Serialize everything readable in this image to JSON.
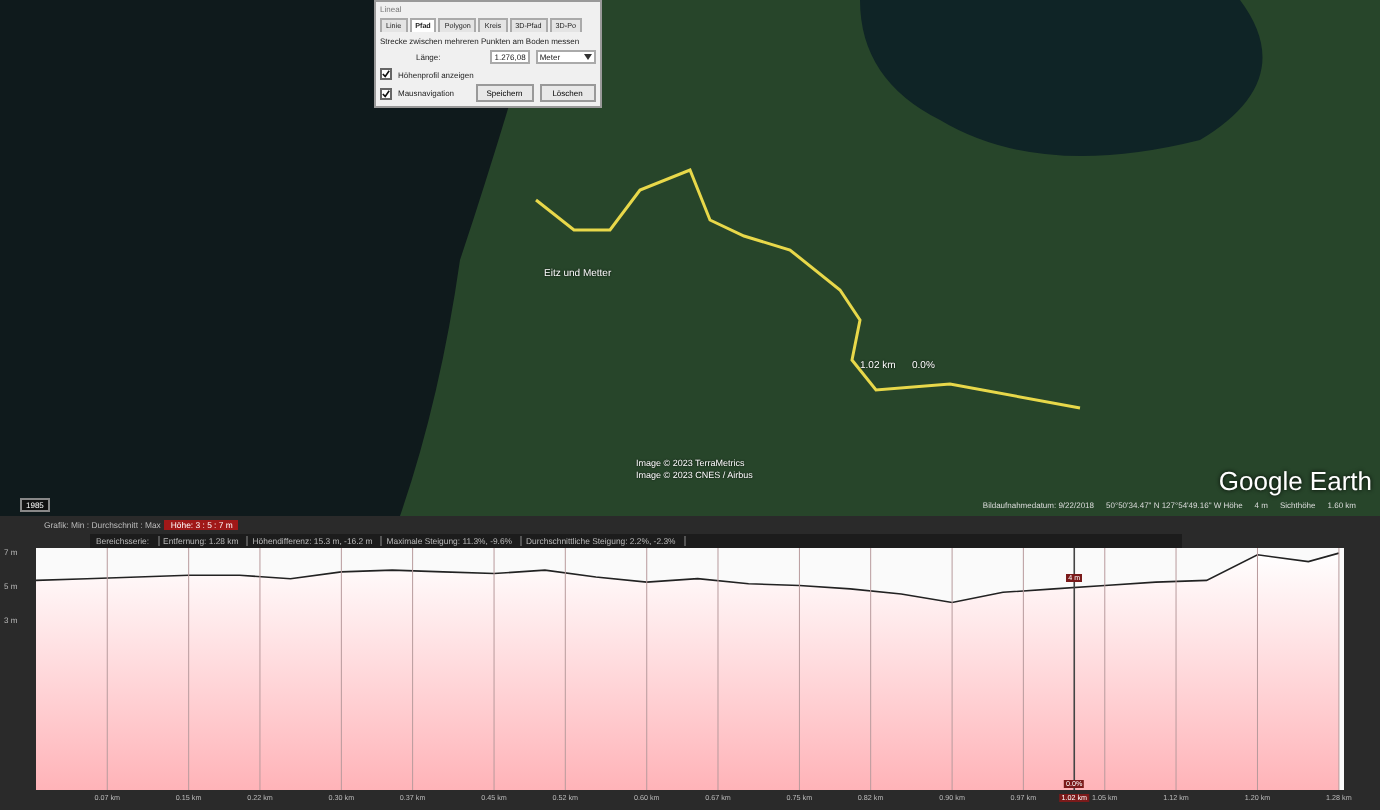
{
  "ruler_dialog": {
    "title": "Lineal",
    "tabs": [
      {
        "label": "Linie",
        "selected": false
      },
      {
        "label": "Pfad",
        "selected": true
      },
      {
        "label": "Polygon",
        "selected": false
      },
      {
        "label": "Kreis",
        "selected": false
      },
      {
        "label": "3D-Pfad",
        "selected": false
      },
      {
        "label": "3D-Po",
        "selected": false
      }
    ],
    "description": "Strecke zwischen mehreren Punkten am Boden messen",
    "length_label": "Länge:",
    "length_value": "1.276,08",
    "unit": "Meter",
    "elevation_profile_checkbox": {
      "label": "Höhenprofil anzeigen",
      "checked": true
    },
    "mouse_navigation_checkbox": {
      "label": "Mausnavigation",
      "checked": true
    },
    "buttons": [
      "Speichern",
      "Löschen"
    ]
  },
  "map": {
    "place_label": "Eitz und Metter",
    "path_distance": "1.02 km",
    "path_slope": "0.0%",
    "attribution": [
      "Image © 2023 TerraMetrics",
      "Image © 2023 CNES / Airbus"
    ],
    "logo": "Google Earth",
    "year_badge": "1985",
    "status_bar": [
      "Bildaufnahmedatum: 9/22/2018",
      "50°50'34.47\" N 127°54'49.16\" W Höhe",
      "4 m",
      "Sichthöhe",
      "1.60 km"
    ]
  },
  "profile": {
    "graph_label": "Grafik: Min : Durchschnitt : Max",
    "graph_value": "Höhe: 3 : 5 : 7 m",
    "stats": [
      "Bereichsserie:",
      "Entfernung: 1.28 km",
      "Höhendifferenz: 15.3 m, -16.2 m",
      "Maximale Steigung: 11.3%, -9.6%",
      "Durchschnittliche Steigung: 2.2%, -2.3%"
    ],
    "chart_data": {
      "type": "line",
      "x": [
        0,
        0.05,
        0.1,
        0.15,
        0.2,
        0.25,
        0.3,
        0.35,
        0.4,
        0.45,
        0.5,
        0.55,
        0.6,
        0.65,
        0.7,
        0.75,
        0.8,
        0.85,
        0.9,
        0.95,
        1.0,
        1.05,
        1.1,
        1.15,
        1.2,
        1.25,
        1.28
      ],
      "series": [
        {
          "color": "#222222",
          "values": [
            5.3,
            5.4,
            5.5,
            5.6,
            5.6,
            5.4,
            5.8,
            5.9,
            5.8,
            5.7,
            5.9,
            5.5,
            5.2,
            5.4,
            5.1,
            5.0,
            4.8,
            4.5,
            4.0,
            4.6,
            4.8,
            5.0,
            5.2,
            5.3,
            6.8,
            6.4,
            6.9
          ]
        }
      ],
      "xlim": [
        0,
        1.285
      ],
      "ylim": [
        -7,
        7.2
      ],
      "grid": true,
      "ref_lines": [
        {
          "axis": "x",
          "value": 1.02,
          "color": "#444444"
        }
      ],
      "yticks": [
        {
          "value": 7,
          "label": "7 m"
        },
        {
          "value": 5,
          "label": "5 m"
        },
        {
          "value": 3,
          "label": "3 m"
        }
      ],
      "xticks": [
        {
          "value": 0.07,
          "label": "0.07 km"
        },
        {
          "value": 0.15,
          "label": "0.15 km"
        },
        {
          "value": 0.22,
          "label": "0.22 km"
        },
        {
          "value": 0.3,
          "label": "0.30 km"
        },
        {
          "value": 0.37,
          "label": "0.37 km"
        },
        {
          "value": 0.45,
          "label": "0.45 km"
        },
        {
          "value": 0.52,
          "label": "0.52 km"
        },
        {
          "value": 0.6,
          "label": "0.60 km"
        },
        {
          "value": 0.67,
          "label": "0.67 km"
        },
        {
          "value": 0.75,
          "label": "0.75 km"
        },
        {
          "value": 0.82,
          "label": "0.82 km"
        },
        {
          "value": 0.9,
          "label": "0.90 km"
        },
        {
          "value": 0.97,
          "label": "0.97 km"
        },
        {
          "value": 1.05,
          "label": "1.05 km"
        },
        {
          "value": 1.12,
          "label": "1.12 km"
        },
        {
          "value": 1.2,
          "label": "1.20 km"
        },
        {
          "value": 1.28,
          "label": "1.28 km"
        }
      ]
    },
    "cursor": {
      "elevation": "4 m",
      "slope": "0.0%",
      "distance": "1.02 km"
    }
  }
}
